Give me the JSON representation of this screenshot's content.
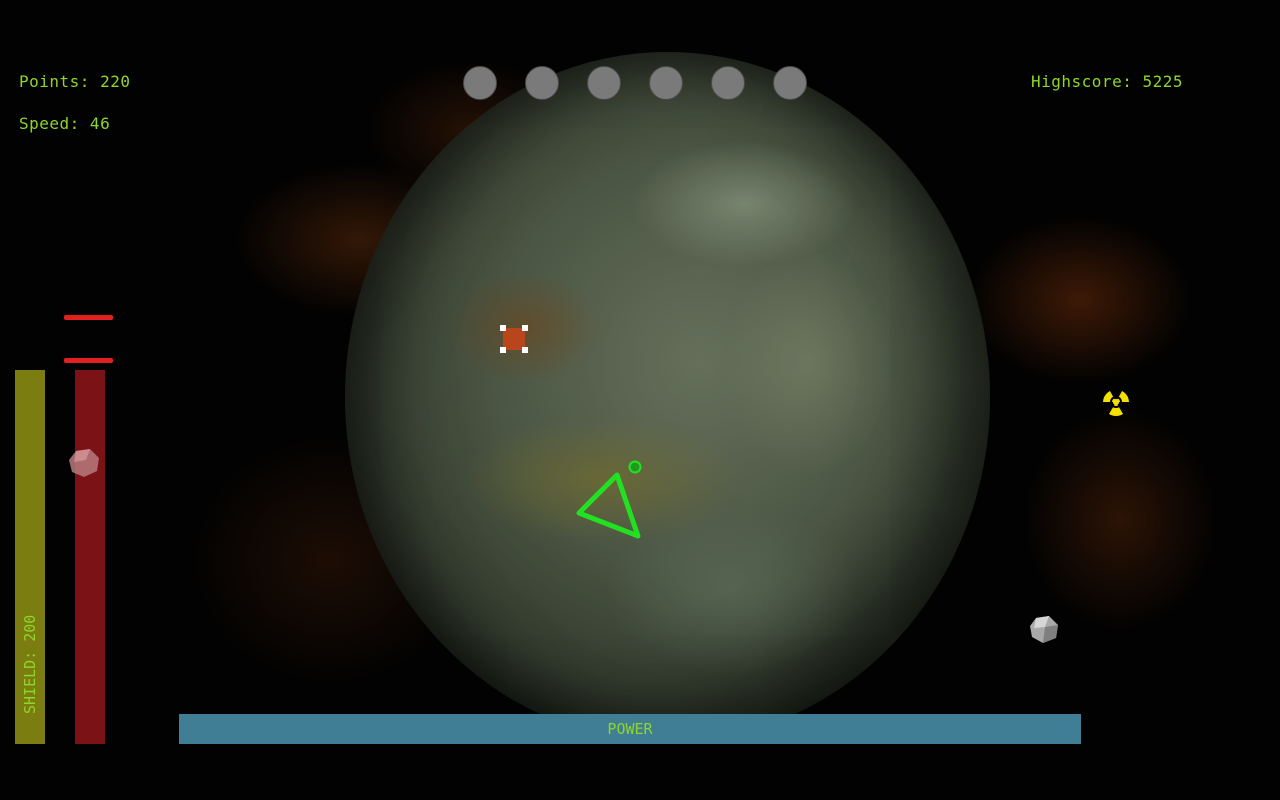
{
  "hud": {
    "points_label": "Points: 220",
    "speed_label": "Speed: 46",
    "highscore_label": "Highscore: 5225",
    "shield_label": "SHIELD: 200",
    "power_label": "POWER"
  },
  "lives": {
    "count": 6
  },
  "colors": {
    "hud_text": "#8ed628",
    "shield_bar": "#7c7d10",
    "heat_bar": "#7b1316",
    "power_bar": "#3f7e95",
    "ship": "#22e022",
    "radiation": "#f2e000"
  },
  "icons": {
    "ship": "triangle-ship-icon",
    "powerup": "red-box-icon",
    "hazard": "radiation-icon",
    "asteroid": "asteroid-icon",
    "life": "life-circle-icon"
  }
}
